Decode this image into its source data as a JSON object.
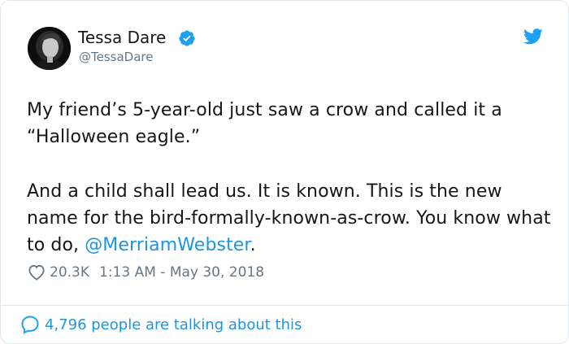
{
  "author": {
    "name": "Tessa Dare",
    "handle": "@TessaDare"
  },
  "tweet": {
    "paragraph1": "My friend’s 5-year-old just saw a crow and called it a “Halloween eagle.”",
    "paragraph2_text": "And a child shall lead us. It is known. This is the new name for the bird-formally-known-as-crow. You know what to do, ",
    "mention": "@MerriamWebster",
    "paragraph2_end": "."
  },
  "meta": {
    "likes": "20.3K",
    "timestamp": "1:13 AM - May 30, 2018"
  },
  "footer": {
    "talking": "4,796 people are talking about this"
  },
  "colors": {
    "brand_blue": "#1da1f2",
    "link_blue": "#1b95e0",
    "secondary_text": "#657786",
    "border": "#e1e8ed"
  },
  "icons": {
    "verified": "verified-badge-icon",
    "platform": "twitter-bird-icon",
    "like": "heart-icon",
    "reply": "speech-bubble-icon"
  }
}
